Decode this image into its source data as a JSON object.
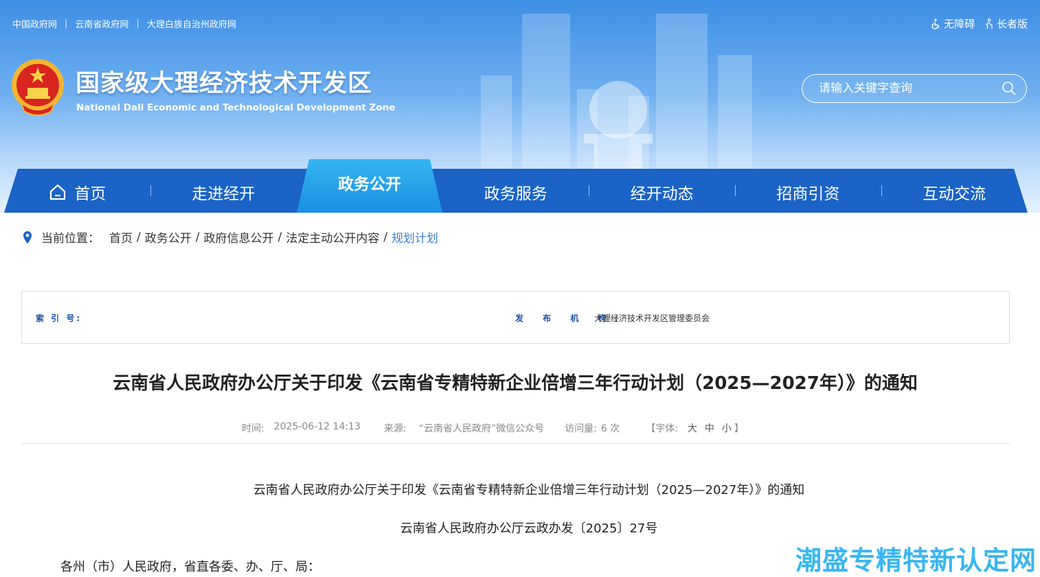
{
  "header": {
    "top_links": [
      "中国政府网",
      "云南省政府网",
      "大理白族自治州政府网"
    ],
    "tools": {
      "accessible": "无障碍",
      "elder": "长者版"
    },
    "site_title": "国家级大理经济技术开发区",
    "site_subtitle": "National Dali Economic and Technological Development Zone",
    "search_placeholder": "请输入关键字查询"
  },
  "nav": {
    "items": [
      "首页",
      "走进经开",
      "政务公开",
      "政务服务",
      "经开动态",
      "招商引资",
      "互动交流"
    ],
    "active": "政务公开"
  },
  "breadcrumb": {
    "label": "当前位置：",
    "items": [
      "首页",
      "政务公开",
      "政府信息公开",
      "法定主动公开内容"
    ],
    "current": "规划计划"
  },
  "meta": {
    "index_label": "索 引 号:",
    "index_value": "",
    "publisher_label": "发 布 机 构:",
    "publisher_value": "大理经济技术开发区管理委员会"
  },
  "article": {
    "title": "云南省人民政府办公厅关于印发《云南省专精特新企业倍增三年行动计划（2025—2027年）》的通知",
    "time_label": "时间:",
    "time_value": "2025-06-12 14:13",
    "source_label": "来源:",
    "source_value": "“云南省人民政府”微信公众号",
    "visits_label": "访问量:",
    "visits_value": "6 次",
    "font_label": "【字体:",
    "font_large": "大",
    "font_medium": "中",
    "font_small": "小",
    "font_close": "】",
    "body_title": "云南省人民政府办公厅关于印发《云南省专精特新企业倍增三年行动计划（2025—2027年）》的通知",
    "doc_number": "云南省人民政府办公厅云政办发〔2025〕27号",
    "salutation": "各州（市）人民政府，省直各委、办、厅、局："
  },
  "watermark": "潮盛专精特新认定网",
  "colors": {
    "nav": "#1b63c6",
    "nav_active": "#1a8fe3",
    "link_current": "#3b7fd0",
    "meta_label": "#1b4fa8"
  }
}
